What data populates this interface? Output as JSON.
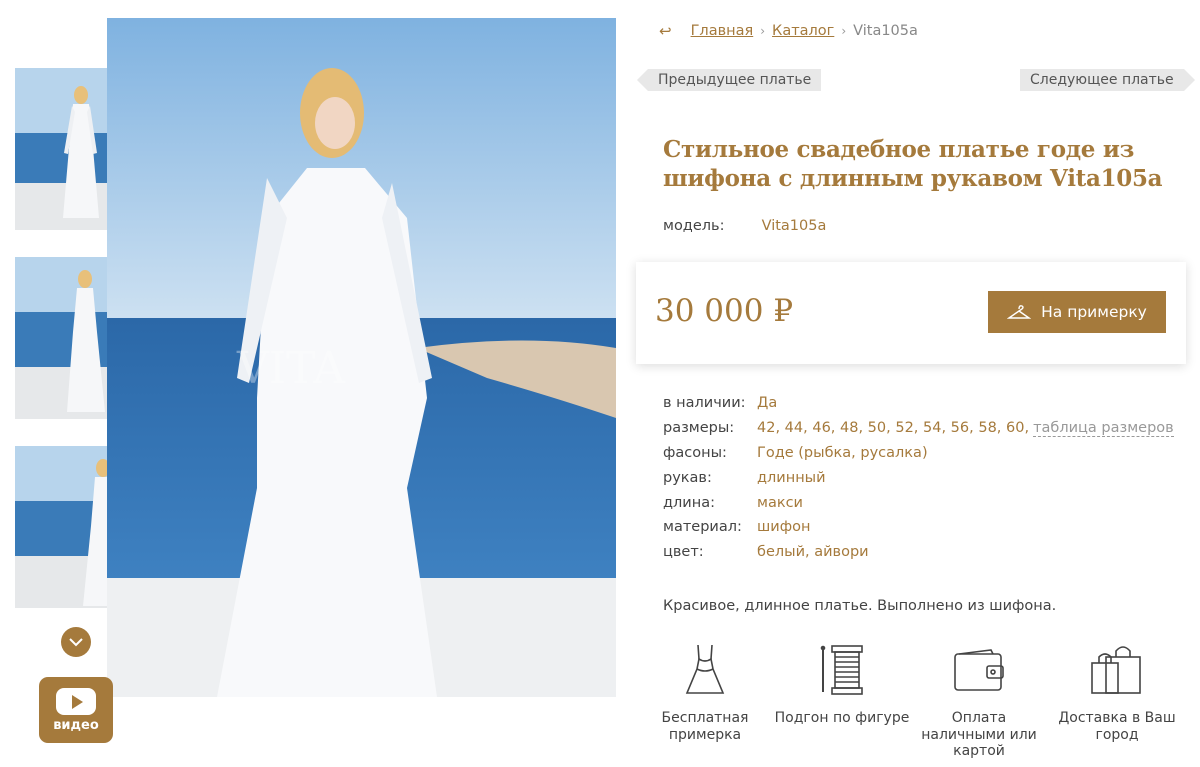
{
  "breadcrumbs": {
    "back_glyph": "↩",
    "home": "Главная",
    "separator": "›",
    "catalog": "Каталог",
    "current": "Vita105a"
  },
  "navigation": {
    "prev": "Предыдущее платье",
    "next": "Следующее платье"
  },
  "product": {
    "title": "Стильное свадебное платье годе из шифона с длинным рукавом Vita105a",
    "model_label": "модель:",
    "model_value": "Vita105a",
    "price": "30 000 ₽",
    "try_on_button": "На примерку",
    "description": "Красивое, длинное платье. Выполнено из шифона."
  },
  "specs": [
    {
      "label": "в наличии:",
      "value": "Да"
    },
    {
      "label": "размеры:",
      "value": "42, 44, 46, 48, 50, 52, 54, 56, 58, 60,",
      "link": "таблица размеров"
    },
    {
      "label": "фасоны:",
      "value": "Годе (рыбка, русалка)"
    },
    {
      "label": "рукав:",
      "value": "длинный"
    },
    {
      "label": "длина:",
      "value": "макси"
    },
    {
      "label": "материал:",
      "value": "шифон"
    },
    {
      "label": "цвет:",
      "value": "белый, айвори"
    }
  ],
  "features": [
    {
      "icon": "dress-icon",
      "label": "Бесплатная примерка"
    },
    {
      "icon": "thread-spool-icon",
      "label": "Подгон по фигуре"
    },
    {
      "icon": "wallet-icon",
      "label": "Оплата наличными или картой"
    },
    {
      "icon": "shopping-bag-icon",
      "label": "Доставка в Ваш город"
    }
  ],
  "gallery": {
    "video_label": "видео",
    "watermark": "VITA"
  },
  "colors": {
    "accent": "#a57a3c",
    "sky": "#a9cbe6",
    "sea": "#2f6fae"
  }
}
